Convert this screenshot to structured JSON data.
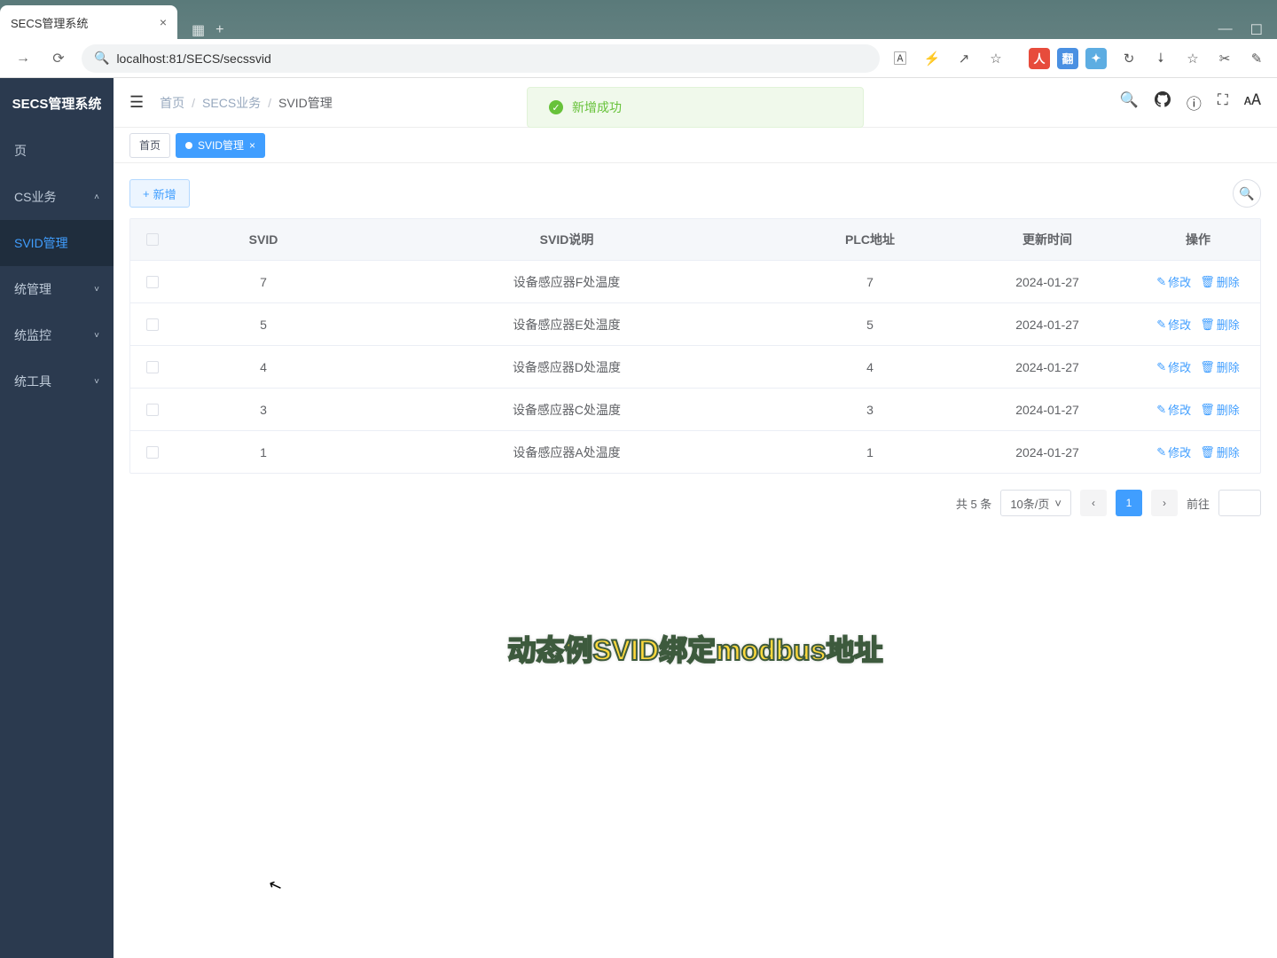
{
  "browser": {
    "tab_title": "SECS管理系统",
    "url": "localhost:81/SECS/secssvid"
  },
  "app": {
    "logo": "SECS管理系统"
  },
  "sidebar": {
    "items": [
      {
        "label": "页",
        "expandable": false
      },
      {
        "label": "CS业务",
        "expandable": true
      },
      {
        "label": "SVID管理",
        "sub": true,
        "active": true
      },
      {
        "label": "统管理",
        "expandable": true
      },
      {
        "label": "统监控",
        "expandable": true
      },
      {
        "label": "统工具",
        "expandable": true
      }
    ]
  },
  "breadcrumb": {
    "items": [
      "首页",
      "SECS业务",
      "SVID管理"
    ]
  },
  "header_icons": {
    "search": "search",
    "github": "github",
    "help": "help",
    "fullscreen": "fullscreen",
    "fontsize": "fontsize"
  },
  "toast": {
    "message": "新增成功"
  },
  "tabs": [
    {
      "label": "首页",
      "active": false
    },
    {
      "label": "SVID管理",
      "active": true,
      "closable": true
    }
  ],
  "toolbar": {
    "add_label": "新增"
  },
  "table": {
    "columns": {
      "svid": "SVID",
      "desc": "SVID说明",
      "plc": "PLC地址",
      "time": "更新时间",
      "action": "操作"
    },
    "action_labels": {
      "edit": "修改",
      "delete": "删除"
    },
    "rows": [
      {
        "svid": "7",
        "desc": "设备感应器F处温度",
        "plc": "7",
        "time": "2024-01-27"
      },
      {
        "svid": "5",
        "desc": "设备感应器E处温度",
        "plc": "5",
        "time": "2024-01-27"
      },
      {
        "svid": "4",
        "desc": "设备感应器D处温度",
        "plc": "4",
        "time": "2024-01-27"
      },
      {
        "svid": "3",
        "desc": "设备感应器C处温度",
        "plc": "3",
        "time": "2024-01-27"
      },
      {
        "svid": "1",
        "desc": "设备感应器A处温度",
        "plc": "1",
        "time": "2024-01-27"
      }
    ]
  },
  "pagination": {
    "total_text": "共 5 条",
    "page_size": "10条/页",
    "current_page": "1",
    "jump_label": "前往"
  },
  "caption": "动态例SVID绑定modbus地址"
}
